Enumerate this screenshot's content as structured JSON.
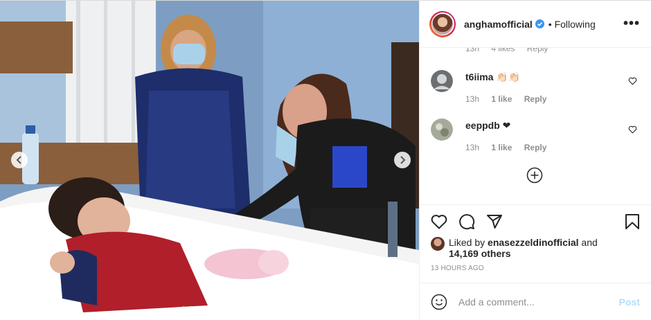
{
  "header": {
    "username": "anghamofficial",
    "following_label": "• Following",
    "more_label": "•••"
  },
  "comments": {
    "partial": {
      "time": "13h",
      "likes": "4 likes",
      "reply": "Reply"
    },
    "items": [
      {
        "user": "t6iima",
        "text": "👏🏻👏🏻",
        "time": "13h",
        "likes": "1 like",
        "reply": "Reply"
      },
      {
        "user": "eeppdb",
        "text": "❤",
        "time": "13h",
        "likes": "1 like",
        "reply": "Reply"
      }
    ]
  },
  "likes": {
    "prefix": "Liked by",
    "user": "enasezzeldinofficial",
    "connector": "and",
    "count": "14,169 others"
  },
  "timestamp": "13 HOURS AGO",
  "add_comment": {
    "placeholder": "Add a comment...",
    "post_label": "Post"
  },
  "colors": {
    "verified": "#3897f0",
    "post_button_disabled": "#b2dffc",
    "muted_text": "#8e8e8e"
  }
}
